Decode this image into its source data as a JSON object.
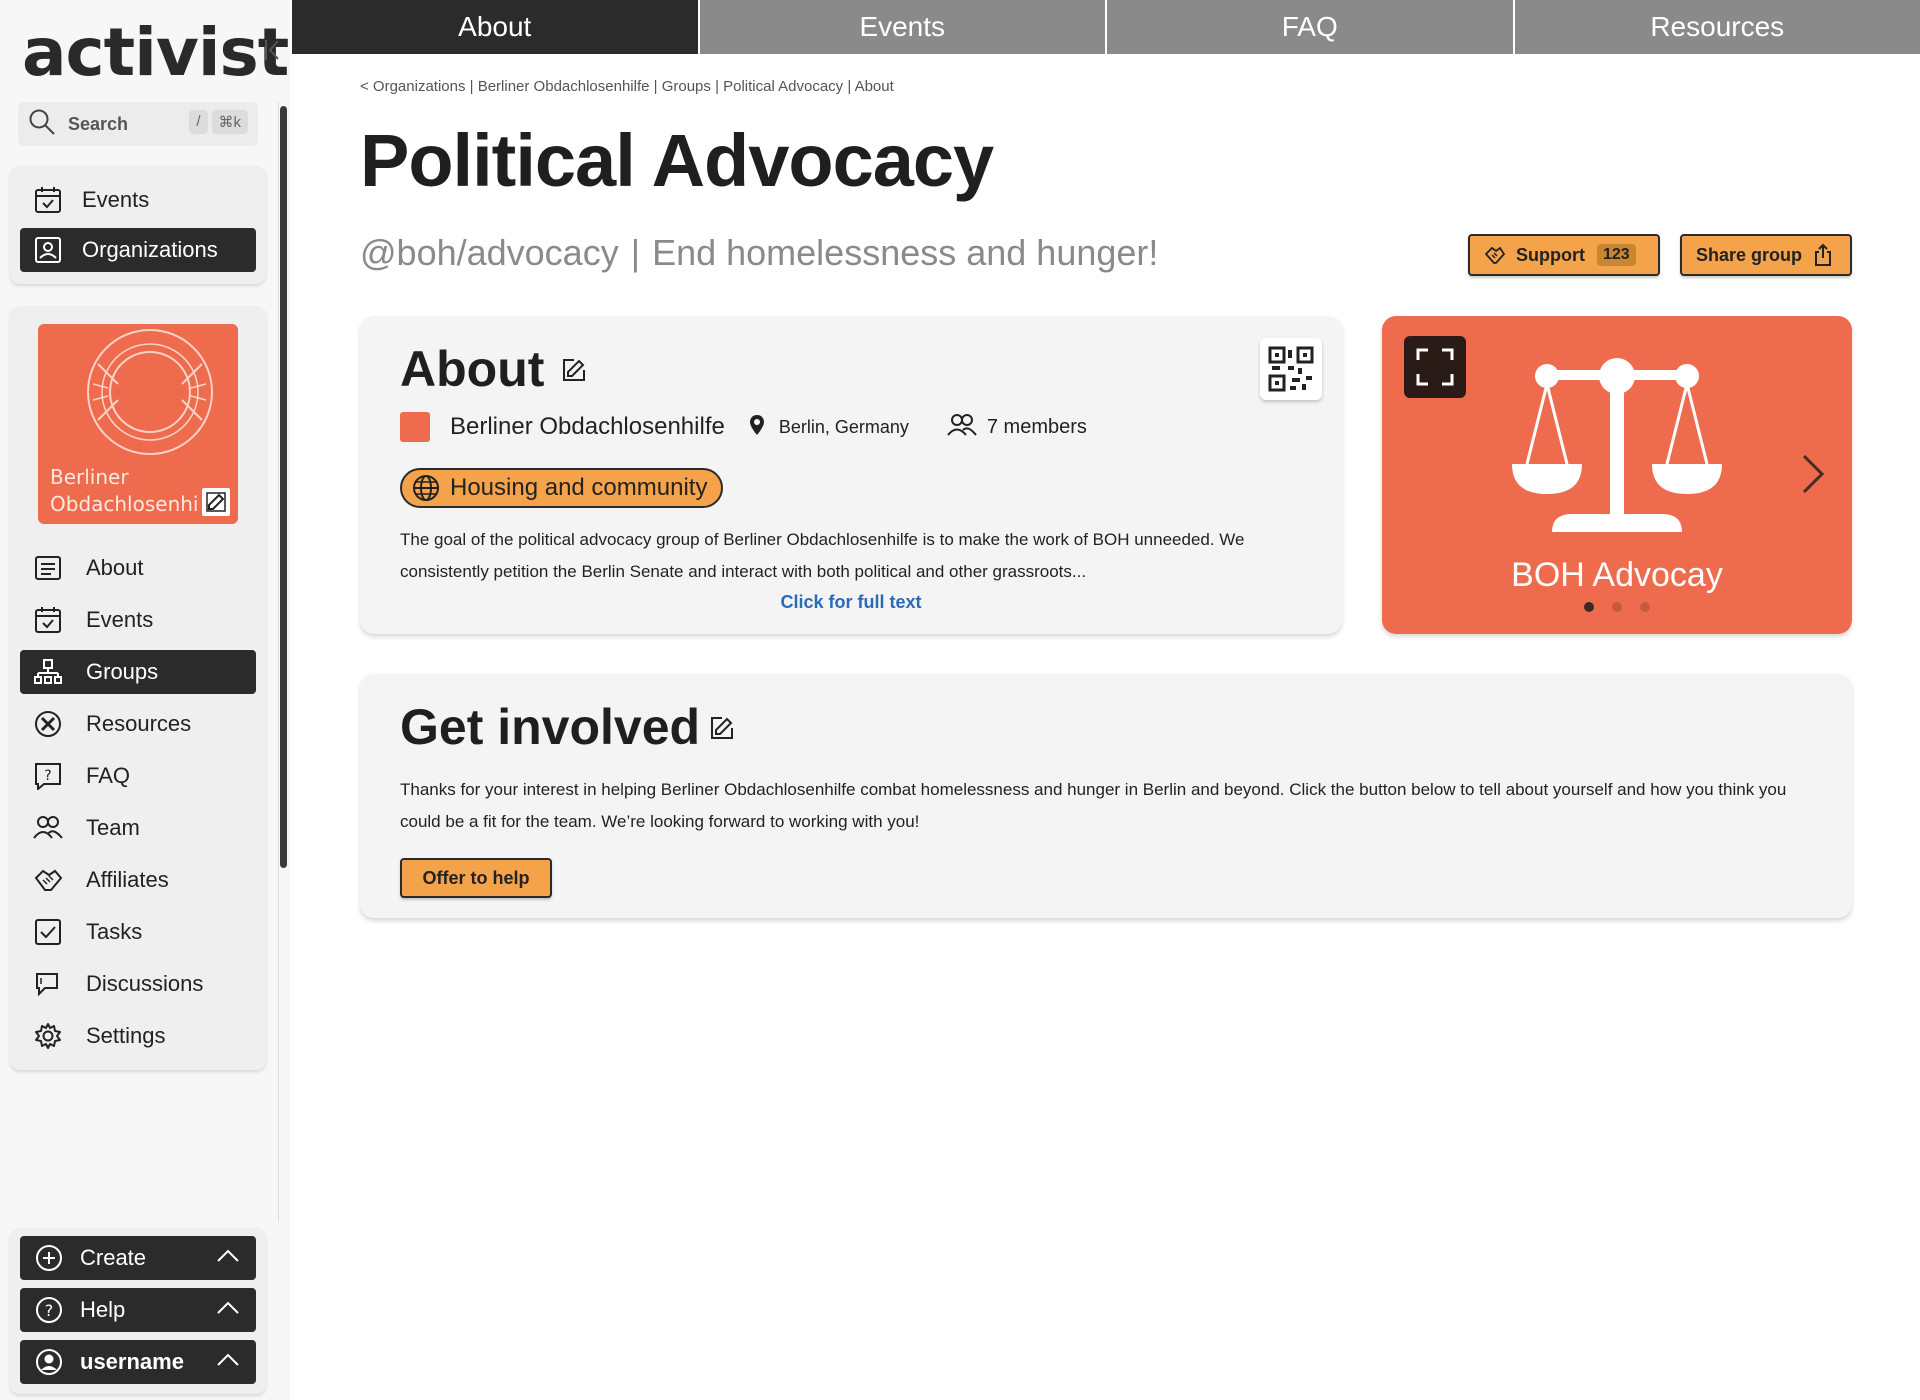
{
  "app": {
    "logo": "activist"
  },
  "sidebar": {
    "search": {
      "label": "Search",
      "shortcut_slash": "/",
      "shortcut_cmd": "⌘k"
    },
    "top_nav": [
      {
        "label": "Events",
        "icon": "calendar-check-icon",
        "active": false
      },
      {
        "label": "Organizations",
        "icon": "organization-icon",
        "active": true
      }
    ],
    "org_image_caption": "Berliner Obdachlosenhilfe",
    "org_menu": [
      {
        "label": "About",
        "icon": "document-icon",
        "active": false
      },
      {
        "label": "Events",
        "icon": "calendar-check-icon",
        "active": false
      },
      {
        "label": "Groups",
        "icon": "hierarchy-icon",
        "active": true
      },
      {
        "label": "Resources",
        "icon": "tools-icon",
        "active": false
      },
      {
        "label": "FAQ",
        "icon": "question-bubble-icon",
        "active": false
      },
      {
        "label": "Team",
        "icon": "people-icon",
        "active": false
      },
      {
        "label": "Affiliates",
        "icon": "handshake-icon",
        "active": false
      },
      {
        "label": "Tasks",
        "icon": "checkbox-icon",
        "active": false
      },
      {
        "label": "Discussions",
        "icon": "chat-icon",
        "active": false
      },
      {
        "label": "Settings",
        "icon": "gear-icon",
        "active": false
      }
    ],
    "bottom": {
      "create": "Create",
      "help": "Help",
      "user": "username"
    }
  },
  "tabs": [
    {
      "label": "About",
      "active": true
    },
    {
      "label": "Events",
      "active": false
    },
    {
      "label": "FAQ",
      "active": false
    },
    {
      "label": "Resources",
      "active": false
    }
  ],
  "breadcrumb": "< Organizations | Berliner Obdachlosenhilfe | Groups | Political Advocacy | About",
  "page": {
    "title": "Political Advocacy",
    "handle": "@boh/advocacy",
    "separator": "|",
    "tagline": "End homelessness and hunger!",
    "support": {
      "label": "Support",
      "count": "123"
    },
    "share": {
      "label": "Share group"
    }
  },
  "about": {
    "title": "About",
    "org_name": "Berliner Obdachlosenhilfe",
    "location": "Berlin, Germany",
    "members": "7 members",
    "topic": "Housing and community",
    "text": "The goal of the political advocacy group of Berliner Obdachlosenhilfe is to make the work of BOH unneeded. We consistently petition the Berlin Senate and interact with both political and other grassroots...",
    "full_text_link": "Click for full text"
  },
  "media": {
    "caption": "BOH Advocay",
    "slides": 3,
    "current_slide": 1
  },
  "involved": {
    "title": "Get involved",
    "text": "Thanks for your interest in helping Berliner Obdachlosenhilfe combat homelessness and hunger in Berlin and beyond. Click the button below to tell about yourself and how you think you could be a fit for the team. We’re looking forward to working with you!",
    "button": "Offer to help"
  },
  "colors": {
    "accent": "#f5a34a",
    "brand_red": "#ee6b4d",
    "dark": "#2b2b2b",
    "link": "#2a6bb8"
  }
}
